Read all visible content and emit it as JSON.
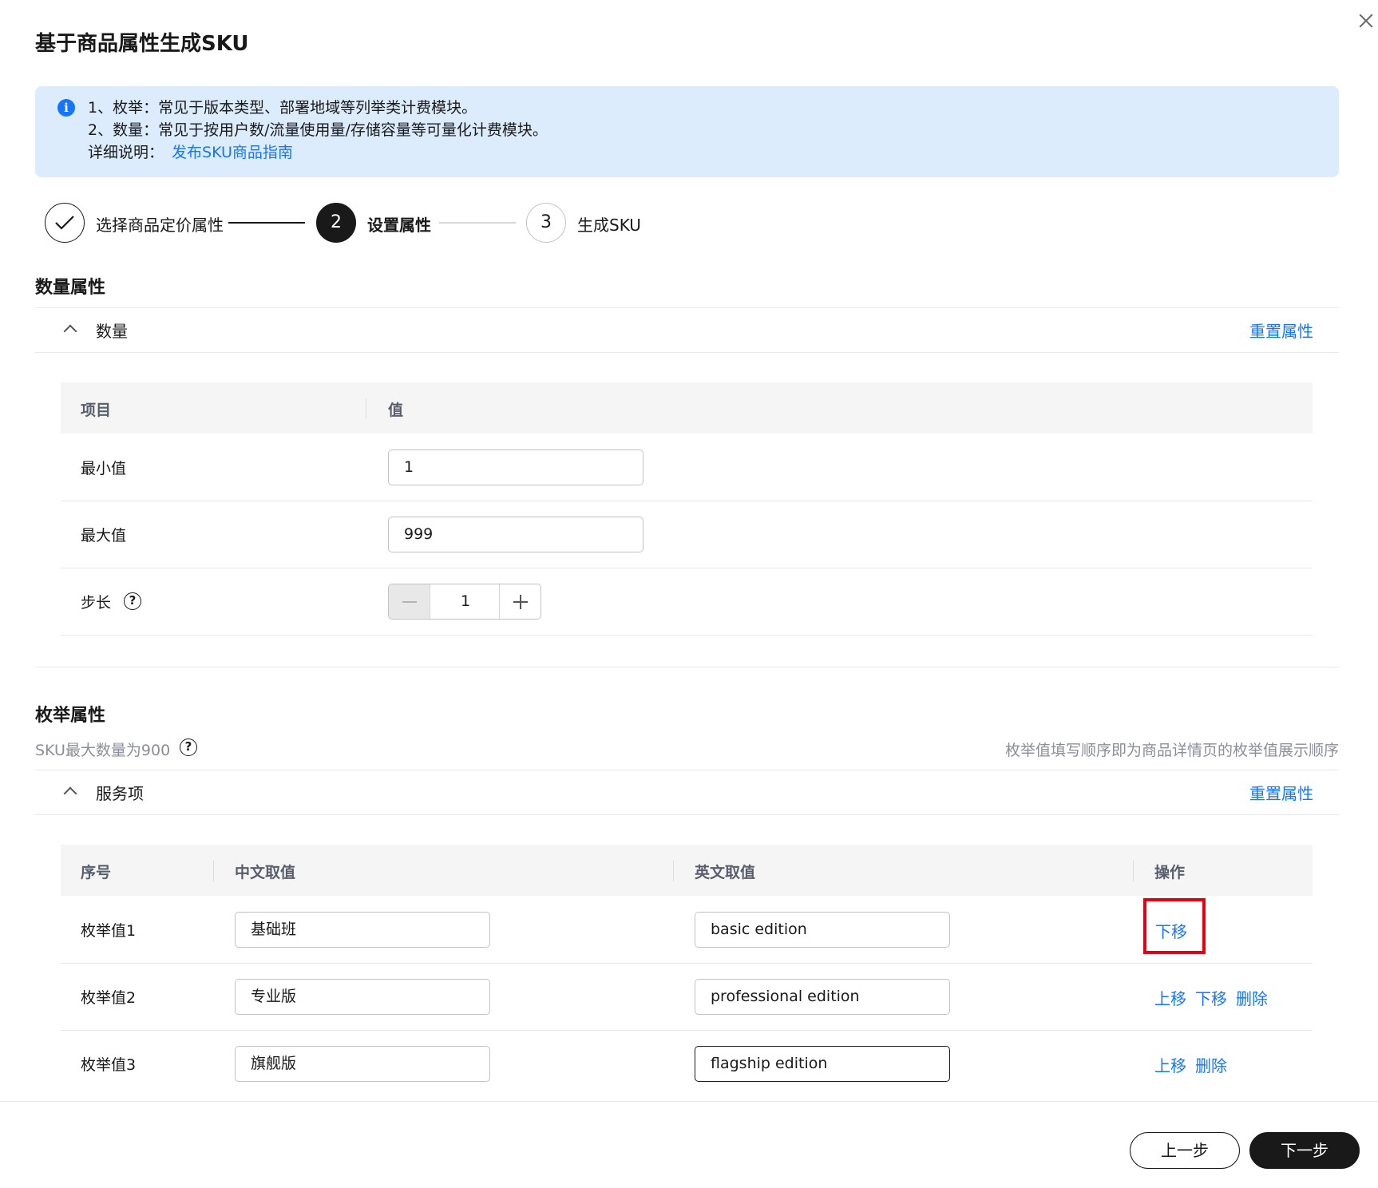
{
  "dialog": {
    "title": "基于商品属性生成SKU",
    "close_label": "×"
  },
  "notice": {
    "line1": "1、枚举：常见于版本类型、部署地域等列举类计费模块。",
    "line2": "2、数量：常见于按用户数/流量使用量/存储容量等可量化计费模块。",
    "line3_prefix": "详细说明：",
    "line3_link": "发布SKU商品指南"
  },
  "steps": [
    {
      "number": "✓",
      "label": "选择商品定价属性",
      "state": "done"
    },
    {
      "number": "2",
      "label": "设置属性",
      "state": "active"
    },
    {
      "number": "3",
      "label": "生成SKU",
      "state": "todo"
    }
  ],
  "quantity_section": {
    "title": "数量属性",
    "group_label": "数量",
    "reset_label": "重置属性",
    "columns": [
      "项目",
      "值"
    ],
    "rows": [
      {
        "label": "最小值",
        "value": "1"
      },
      {
        "label": "最大值",
        "value": "999"
      },
      {
        "label": "步长",
        "value": "1"
      }
    ]
  },
  "enum_section": {
    "title": "枚举属性",
    "sku_limit_note": "SKU最大数量为900",
    "order_note": "枚举值填写顺序即为商品详情页的枚举值展示顺序",
    "group_label": "服务项",
    "reset_label": "重置属性",
    "columns": [
      "序号",
      "中文取值",
      "英文取值",
      "操作"
    ],
    "rows": [
      {
        "index": "枚举值1",
        "zh": "基础班",
        "en": "basic edition",
        "actions": [
          "下移"
        ]
      },
      {
        "index": "枚举值2",
        "zh": "专业版",
        "en": "professional edition",
        "actions": [
          "上移",
          "下移",
          "删除"
        ]
      },
      {
        "index": "枚举值3",
        "zh": "旗舰版",
        "en": "flagship edition",
        "actions": [
          "上移",
          "删除"
        ]
      }
    ]
  },
  "footer": {
    "prev_label": "上一步",
    "next_label": "下一步"
  },
  "colors": {
    "accent": "#1476ff",
    "notice_bg": "#dcecfd",
    "highlight": "#e6000f",
    "primary_button": "#191919"
  }
}
